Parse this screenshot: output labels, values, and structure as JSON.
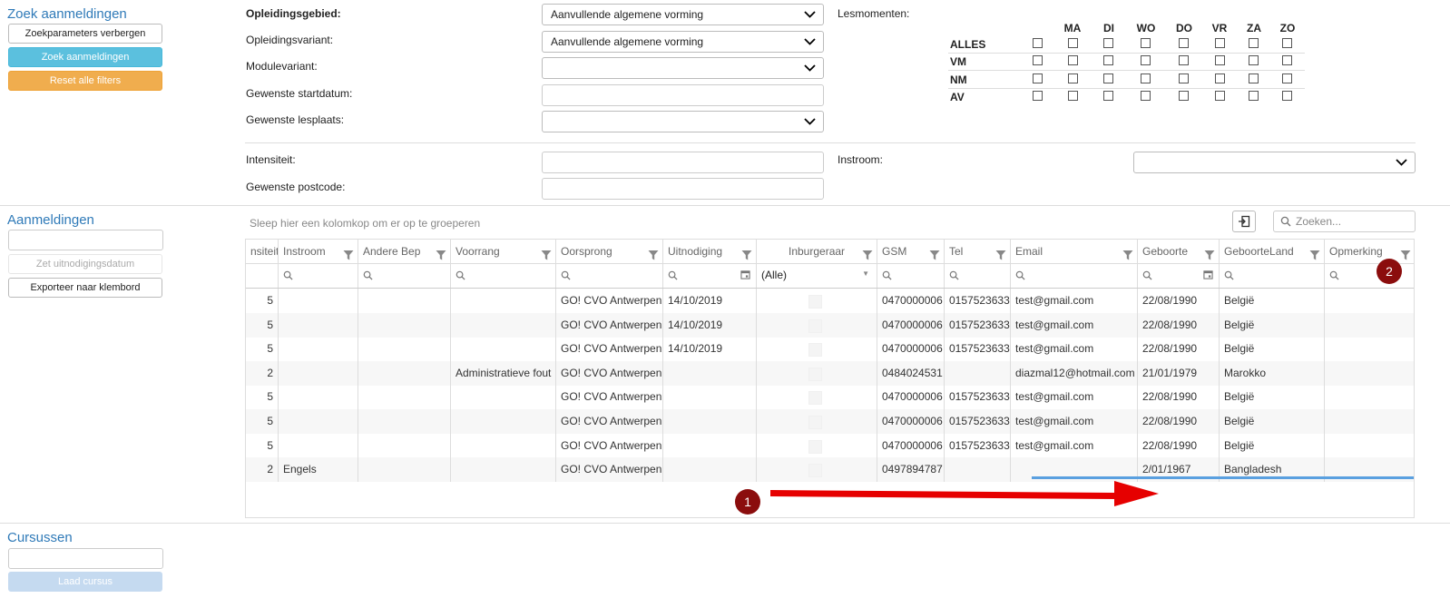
{
  "search_section": {
    "title": "Zoek aanmeldingen",
    "btn_hide": "Zoekparameters verbergen",
    "btn_search": "Zoek aanmeldingen",
    "btn_reset": "Reset alle filters"
  },
  "filters": {
    "opleidingsgebied": {
      "label": "Opleidingsgebied:",
      "value": "Aanvullende algemene vorming"
    },
    "opleidingsvariant": {
      "label": "Opleidingsvariant:",
      "value": "Aanvullende algemene vorming"
    },
    "modulevariant": {
      "label": "Modulevariant:",
      "value": ""
    },
    "startdatum": {
      "label": "Gewenste startdatum:",
      "value": ""
    },
    "lesplaats": {
      "label": "Gewenste lesplaats:",
      "value": ""
    },
    "intensiteit": {
      "label": "Intensiteit:",
      "value": ""
    },
    "postcode": {
      "label": "Gewenste postcode:",
      "value": ""
    },
    "instroom": {
      "label": "Instroom:",
      "value": ""
    }
  },
  "lesmomenten": {
    "label": "Lesmomenten:",
    "days": [
      "MA",
      "DI",
      "WO",
      "DO",
      "VR",
      "ZA",
      "ZO"
    ],
    "rows": [
      "ALLES",
      "VM",
      "NM",
      "AV"
    ]
  },
  "registrations": {
    "title": "Aanmeldingen",
    "input_value": "",
    "btn_set_date": "Zet uitnodigingsdatum",
    "btn_export": "Exporteer naar klembord"
  },
  "courses": {
    "title": "Cursussen",
    "input_value": "",
    "btn_load": "Laad cursus"
  },
  "grid": {
    "group_hint": "Sleep hier een kolomkop om er op te groeperen",
    "search_placeholder": "Zoeken...",
    "columns": [
      "nsiteit",
      "Instroom",
      "Andere Bep",
      "Voorrang",
      "Oorsprong",
      "Uitnodiging",
      "Inburgeraar",
      "GSM",
      "Tel",
      "Email",
      "Geboorte",
      "GeboorteLand",
      "Opmerking"
    ],
    "inburgeraar_filter": "(Alle)",
    "rows": [
      [
        "5",
        "",
        "",
        "",
        "GO! CVO Antwerpen",
        "14/10/2019",
        "",
        "0470000006",
        "0157523633",
        "test@gmail.com",
        "22/08/1990",
        "België",
        ""
      ],
      [
        "5",
        "",
        "",
        "",
        "GO! CVO Antwerpen",
        "14/10/2019",
        "",
        "0470000006",
        "0157523633",
        "test@gmail.com",
        "22/08/1990",
        "België",
        ""
      ],
      [
        "5",
        "",
        "",
        "",
        "GO! CVO Antwerpen",
        "14/10/2019",
        "",
        "0470000006",
        "0157523633",
        "test@gmail.com",
        "22/08/1990",
        "België",
        ""
      ],
      [
        "2",
        "",
        "",
        "Administratieve fout",
        "GO! CVO Antwerpen",
        "",
        "",
        "0484024531",
        "",
        "diazmal12@hotmail.com",
        "21/01/1979",
        "Marokko",
        ""
      ],
      [
        "5",
        "",
        "",
        "",
        "GO! CVO Antwerpen",
        "",
        "",
        "0470000006",
        "0157523633",
        "test@gmail.com",
        "22/08/1990",
        "België",
        ""
      ],
      [
        "5",
        "",
        "",
        "",
        "GO! CVO Antwerpen",
        "",
        "",
        "0470000006",
        "0157523633",
        "test@gmail.com",
        "22/08/1990",
        "België",
        ""
      ],
      [
        "5",
        "",
        "",
        "",
        "GO! CVO Antwerpen",
        "",
        "",
        "0470000006",
        "0157523633",
        "test@gmail.com",
        "22/08/1990",
        "België",
        ""
      ],
      [
        "2",
        "Engels",
        "",
        "",
        "GO! CVO Antwerpen",
        "",
        "",
        "0497894787",
        "",
        "",
        "2/01/1967",
        "Bangladesh",
        ""
      ]
    ]
  },
  "annotations": {
    "marker1": "1",
    "marker2": "2"
  },
  "colors": {
    "link_blue": "#2f7ab8",
    "btn_blue": "#5bc0de",
    "btn_orange": "#f0ad4e",
    "marker": "#8b0d0d",
    "arrow": "#e60000"
  }
}
